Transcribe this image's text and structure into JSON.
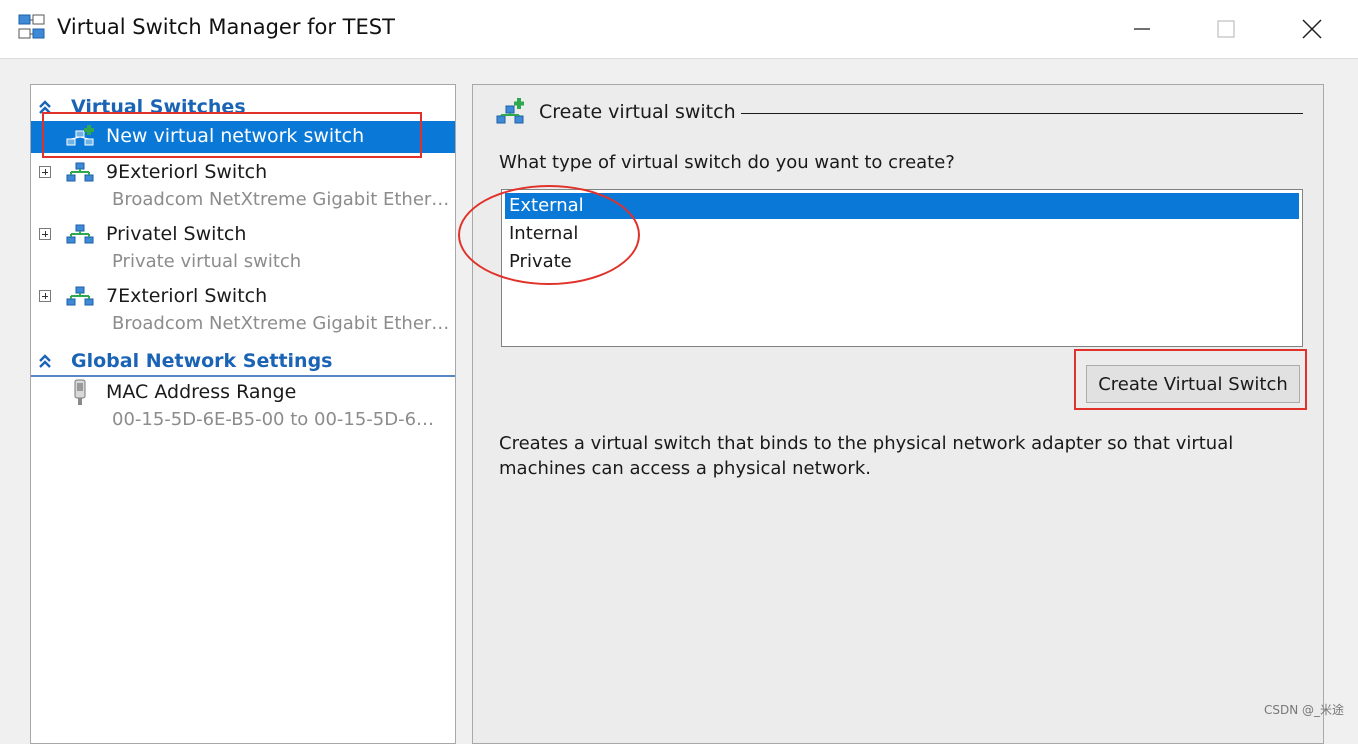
{
  "window": {
    "title": "Virtual Switch Manager for TEST",
    "icon": "virtual-switch-manager-icon",
    "controls": [
      "minimize",
      "maximize",
      "close"
    ]
  },
  "sidebar": {
    "sections": [
      {
        "title": "Virtual Switches",
        "items": [
          {
            "label": "New virtual network switch",
            "selected": true
          },
          {
            "label": "9Exteriorl Switch",
            "sub": "Broadcom NetXtreme Gigabit Ether…"
          },
          {
            "label": "Privatel Switch",
            "sub": "Private virtual switch"
          },
          {
            "label": "7Exteriorl Switch",
            "sub": "Broadcom NetXtreme Gigabit Ether…"
          }
        ]
      },
      {
        "title": "Global Network Settings",
        "items": [
          {
            "label": "MAC Address Range",
            "sub": "00-15-5D-6E-B5-00 to 00-15-5D-6…"
          }
        ]
      }
    ]
  },
  "main": {
    "title": "Create virtual switch",
    "question": "What type of virtual switch do you want to create?",
    "types": [
      "External",
      "Internal",
      "Private"
    ],
    "selected_type": "External",
    "create_button": "Create Virtual Switch",
    "description": "Creates a virtual switch that binds to the physical network adapter so that virtual machines can access a physical network."
  },
  "watermark": "CSDN @_米途",
  "colors": {
    "selection": "#0a78d7",
    "section_header": "#1b64b5",
    "annotation_red": "#e0322a"
  }
}
